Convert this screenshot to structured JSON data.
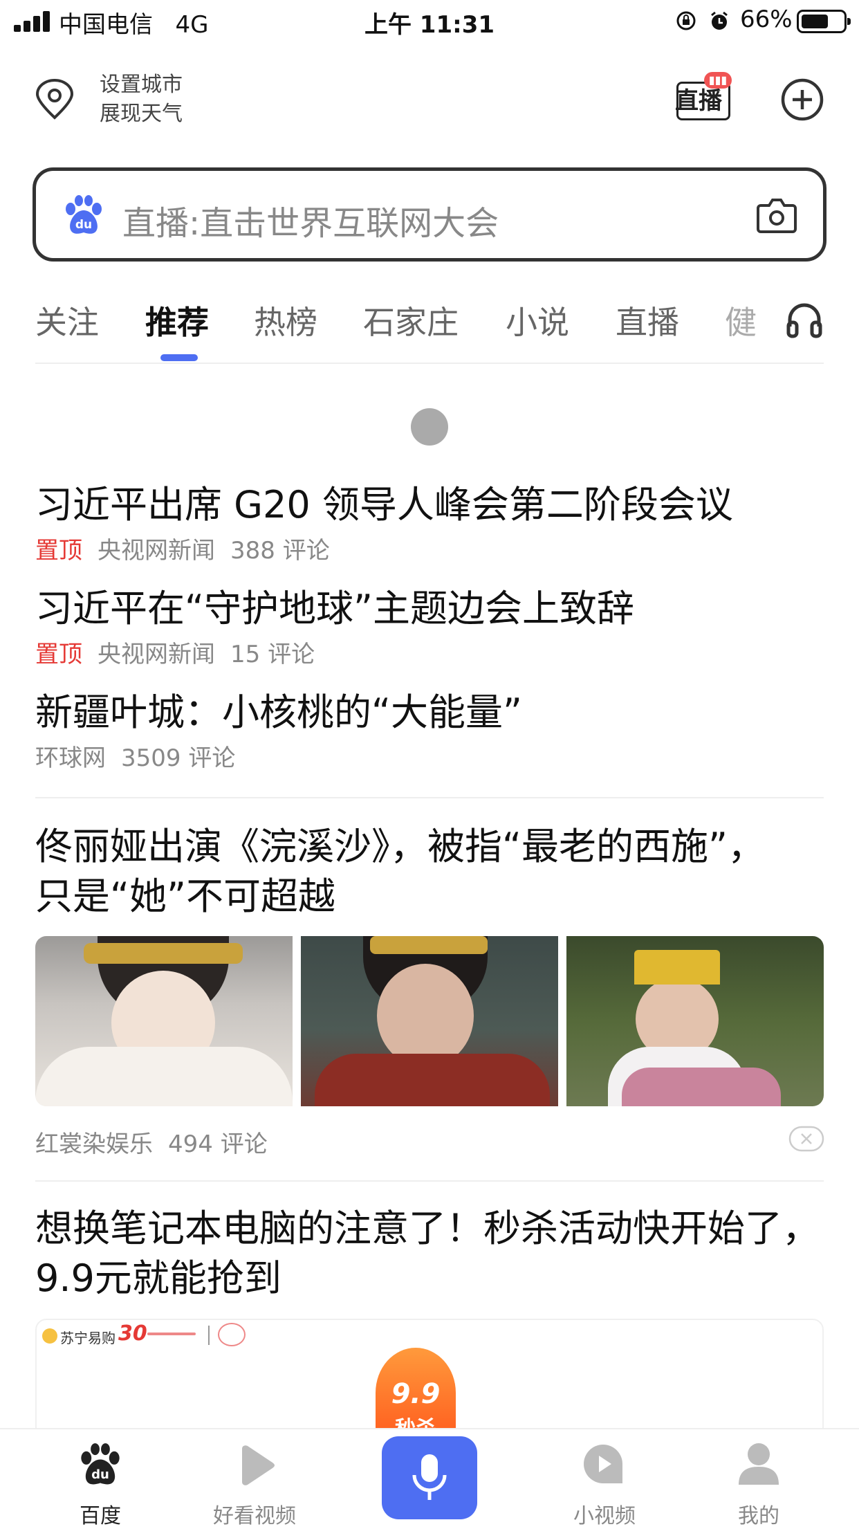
{
  "status_bar": {
    "carrier": "中国电信",
    "network": "4G",
    "time": "上午 11:31",
    "battery_percent": "66%",
    "battery_level": 0.66
  },
  "header": {
    "weather_line1": "设置城市",
    "weather_line2": "展现天气",
    "live_label": "直播",
    "plus_icon": "plus-circle-icon"
  },
  "search": {
    "placeholder": "直播:直击世界互联网大会",
    "logo": "du",
    "camera_icon": "camera-icon"
  },
  "tabs": [
    {
      "label": "关注"
    },
    {
      "label": "推荐",
      "active": true
    },
    {
      "label": "热榜"
    },
    {
      "label": "石家庄"
    },
    {
      "label": "小说"
    },
    {
      "label": "直播"
    },
    {
      "label": "健"
    }
  ],
  "news": [
    {
      "title": "习近平出席 G20 领导人峰会第二阶段会议",
      "pinned": "置顶",
      "source": "央视网新闻",
      "comments": "388 评论"
    },
    {
      "title": "习近平在“守护地球”主题边会上致辞",
      "pinned": "置顶",
      "source": "央视网新闻",
      "comments": "15 评论"
    },
    {
      "title": "新疆叶城：小核桃的“大能量”",
      "source": "环球网",
      "comments": "3509 评论"
    }
  ],
  "feature": {
    "title": "佟丽娅出演《浣溪沙》，被指“最老的西施”，只是“她”不可超越",
    "source": "红裳染娱乐",
    "comments": "494 评论"
  },
  "ad": {
    "title": "想换笔记本电脑的注意了！秒杀活动快开始了，9.9元就能抢到",
    "brand": "苏宁易购",
    "anniv": "30",
    "badge_price": "9.9",
    "badge_text": "秒杀"
  },
  "bottom_nav": [
    {
      "label": "百度",
      "icon": "baidu-paw-icon",
      "active": true
    },
    {
      "label": "好看视频",
      "icon": "play-icon"
    },
    {
      "label": "",
      "icon": "microphone-icon"
    },
    {
      "label": "小视频",
      "icon": "small-video-icon"
    },
    {
      "label": "我的",
      "icon": "user-icon"
    }
  ],
  "colors": {
    "accent": "#4e6ef2",
    "pin": "#e53935",
    "text": "#111111",
    "muted": "#888888"
  }
}
